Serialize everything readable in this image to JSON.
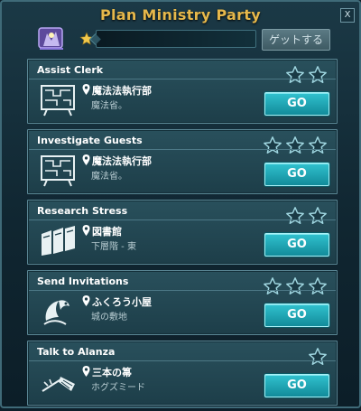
{
  "header": {
    "title": "Plan Ministry Party",
    "close_label": "X",
    "get_button": "ゲットする",
    "progress": 0,
    "colors": {
      "title": "#e6b84b",
      "go_button": "#1fb0bf",
      "panel": "#1b3946"
    }
  },
  "tasks": [
    {
      "title": "Assist Clerk",
      "location": "魔法法執行部",
      "sublocation": "魔法省。",
      "stars": 2,
      "icon": "map-board-icon",
      "go_label": "GO"
    },
    {
      "title": "Investigate Guests",
      "location": "魔法法執行部",
      "sublocation": "魔法省。",
      "stars": 3,
      "icon": "map-board-icon",
      "go_label": "GO"
    },
    {
      "title": "Research Stress",
      "location": "図書館",
      "sublocation": "下層階 - 東",
      "stars": 2,
      "icon": "books-icon",
      "go_label": "GO"
    },
    {
      "title": "Send Invitations",
      "location": "ふくろう小屋",
      "sublocation": "城の敷地",
      "stars": 3,
      "icon": "owl-letter-icon",
      "go_label": "GO"
    },
    {
      "title": "Talk to Alanza",
      "location": "三本の箒",
      "sublocation": "ホグズミード",
      "stars": 1,
      "icon": "broom-icon",
      "go_label": "GO"
    }
  ]
}
